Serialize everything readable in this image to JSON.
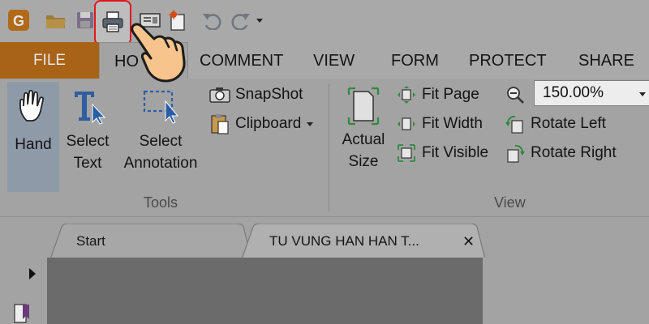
{
  "quick_access": {
    "icons": [
      "app-logo-icon",
      "open-folder-icon",
      "save-icon",
      "print-icon",
      "scan-icon",
      "new-document-icon",
      "undo-icon",
      "redo-icon",
      "customize-dropdown-icon"
    ]
  },
  "tabs": {
    "file": "FILE",
    "home": "HO",
    "comment": "COMMENT",
    "view": "VIEW",
    "form": "FORM",
    "protect": "PROTECT",
    "share": "SHARE"
  },
  "ribbon": {
    "tools": {
      "hand": "Hand",
      "select_text_1": "Select",
      "select_text_2": "Text",
      "select_annotation_1": "Select",
      "select_annotation_2": "Annotation",
      "snapshot": "SnapShot",
      "clipboard": "Clipboard",
      "group_label": "Tools"
    },
    "view": {
      "actual_size_1": "Actual",
      "actual_size_2": "Size",
      "fit_page": "Fit Page",
      "fit_width": "Fit Width",
      "fit_visible": "Fit Visible",
      "zoom_value": "150.00%",
      "rotate_left": "Rotate Left",
      "rotate_right": "Rotate Right",
      "group_label": "View"
    }
  },
  "documents": {
    "tabs": [
      "Start",
      "TU VUNG HAN HAN T..."
    ]
  },
  "colors": {
    "file_tab": "#a86316",
    "highlight": "#e0161d",
    "hand_selected": "#8e9aa8"
  }
}
